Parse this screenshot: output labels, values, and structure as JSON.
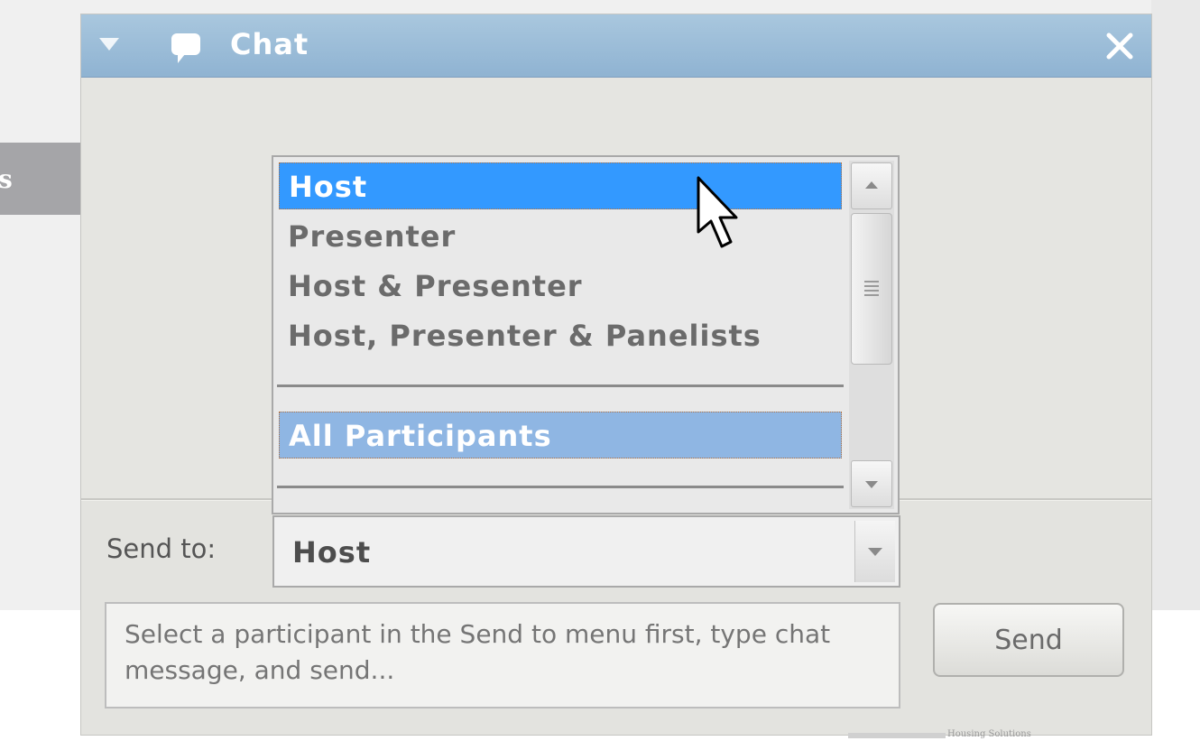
{
  "callout": {
    "text": "s"
  },
  "chat_window": {
    "title": "Chat",
    "colors": {
      "title_bar": "#9dbcd8",
      "highlight": "#3399ff",
      "current_item": "#8fb6e3"
    },
    "icons": {
      "collapse": "triangle-down-icon",
      "chat": "chat-bubble-icon",
      "close": "close-icon"
    }
  },
  "send_to": {
    "label": "Send to:",
    "selected_value": "Host",
    "options": [
      {
        "label": "Host",
        "state": "hovered"
      },
      {
        "label": "Presenter"
      },
      {
        "label": "Host & Presenter"
      },
      {
        "label": "Host, Presenter & Panelists"
      },
      {
        "label": "All Participants",
        "state": "current"
      }
    ]
  },
  "message": {
    "placeholder": "Select a participant in the Send to menu first, type chat message, and send..."
  },
  "send_button": {
    "label": "Send"
  },
  "footer": {
    "watermark": "Housing Solutions"
  }
}
